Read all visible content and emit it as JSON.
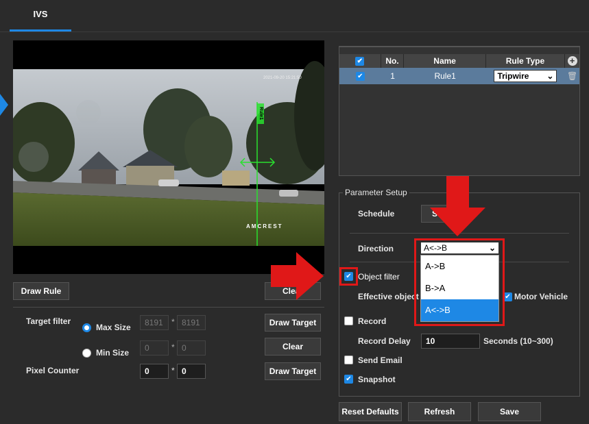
{
  "tabs": {
    "active": "IVS"
  },
  "video": {
    "watermark": "AMCREST",
    "timestamp": "2021-09-20 15:21:50",
    "rule_label": "Rule1"
  },
  "left_panel": {
    "draw_rule_label": "Draw Rule",
    "clear_label": "Clear",
    "target_filter_label": "Target filter",
    "max_size_label": "Max Size",
    "min_size_label": "Min Size",
    "max_w": "8191",
    "max_h": "8191",
    "min_w": "0",
    "min_h": "0",
    "times": "*",
    "pixel_counter_label": "Pixel Counter",
    "pixel_w": "0",
    "pixel_h": "0",
    "draw_target_label": "Draw Target",
    "clear2_label": "Clear",
    "draw_target2_label": "Draw Target"
  },
  "rule_table": {
    "headers": [
      "No.",
      "Name",
      "Rule Type"
    ],
    "rows": [
      {
        "no": "1",
        "name": "Rule1",
        "type": "Tripwire"
      }
    ]
  },
  "params": {
    "legend": "Parameter Setup",
    "schedule_label": "Schedule",
    "schedule_button": "S",
    "direction_label": "Direction",
    "direction_value": "A<->B",
    "direction_options": [
      "A->B",
      "B->A",
      "A<->B"
    ],
    "object_filter_label": "Object filter",
    "effective_object_label": "Effective object",
    "motor_vehicle_label": "Motor Vehicle",
    "record_label": "Record",
    "record_delay_label": "Record Delay",
    "record_delay_value": "10",
    "record_delay_unit": "Seconds (10~300)",
    "send_email_label": "Send Email",
    "snapshot_label": "Snapshot"
  },
  "footer": {
    "reset_label": "Reset Defaults",
    "refresh_label": "Refresh",
    "save_label": "Save"
  },
  "colors": {
    "accent": "#1e88e5",
    "highlight": "#e01818",
    "row_selected": "#5b7b9c"
  }
}
